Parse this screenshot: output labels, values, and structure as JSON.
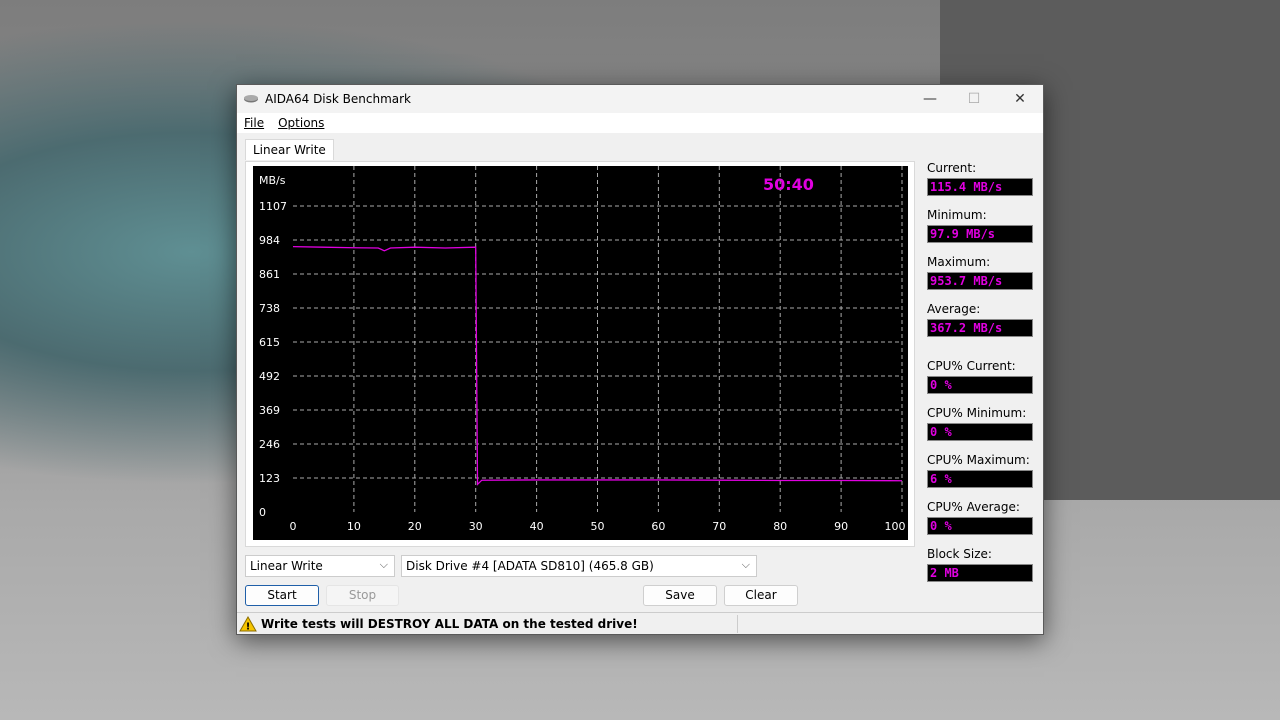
{
  "window": {
    "title": "AIDA64 Disk Benchmark",
    "minimize": "—",
    "maximize": "☐",
    "close": "✕"
  },
  "menu": [
    "File",
    "Options"
  ],
  "tab": "Linear Write",
  "chart": {
    "unit": "MB/s",
    "timer": "50:40",
    "y_ticks": [
      "1107",
      "984",
      "861",
      "738",
      "615",
      "492",
      "369",
      "246",
      "123",
      "0"
    ],
    "x_ticks": [
      "0",
      "10",
      "20",
      "30",
      "40",
      "50",
      "60",
      "70",
      "80",
      "90",
      "100 %"
    ],
    "line_color": "#e000e0"
  },
  "chart_data": {
    "type": "line",
    "xlabel": "%",
    "ylabel": "MB/s",
    "xlim": [
      0,
      100
    ],
    "ylim": [
      0,
      1107
    ],
    "x": [
      0,
      5,
      10,
      14,
      15,
      16,
      20,
      25,
      29.9,
      30,
      30.3,
      31,
      40,
      50,
      60,
      70,
      80,
      90,
      100
    ],
    "values": [
      960,
      958,
      956,
      955,
      945,
      955,
      958,
      955,
      958,
      958,
      100,
      115,
      116,
      116,
      116,
      115,
      114,
      114,
      113
    ]
  },
  "stats": [
    {
      "label": "Current:",
      "value": "115.4 MB/s"
    },
    {
      "label": "Minimum:",
      "value": "97.9 MB/s"
    },
    {
      "label": "Maximum:",
      "value": "953.7 MB/s"
    },
    {
      "label": "Average:",
      "value": "367.2 MB/s"
    },
    {
      "label": "CPU% Current:",
      "value": "0 %"
    },
    {
      "label": "CPU% Minimum:",
      "value": "0 %"
    },
    {
      "label": "CPU% Maximum:",
      "value": "6 %"
    },
    {
      "label": "CPU% Average:",
      "value": "0 %"
    },
    {
      "label": "Block Size:",
      "value": "2 MB"
    }
  ],
  "controls": {
    "test_select": "Linear Write",
    "drive_select": "Disk Drive #4  [ADATA   SD810]  (465.8 GB)",
    "start": "Start",
    "stop": "Stop",
    "save": "Save",
    "clear": "Clear"
  },
  "status": {
    "warning": "Write tests will DESTROY ALL DATA on the tested drive!"
  }
}
